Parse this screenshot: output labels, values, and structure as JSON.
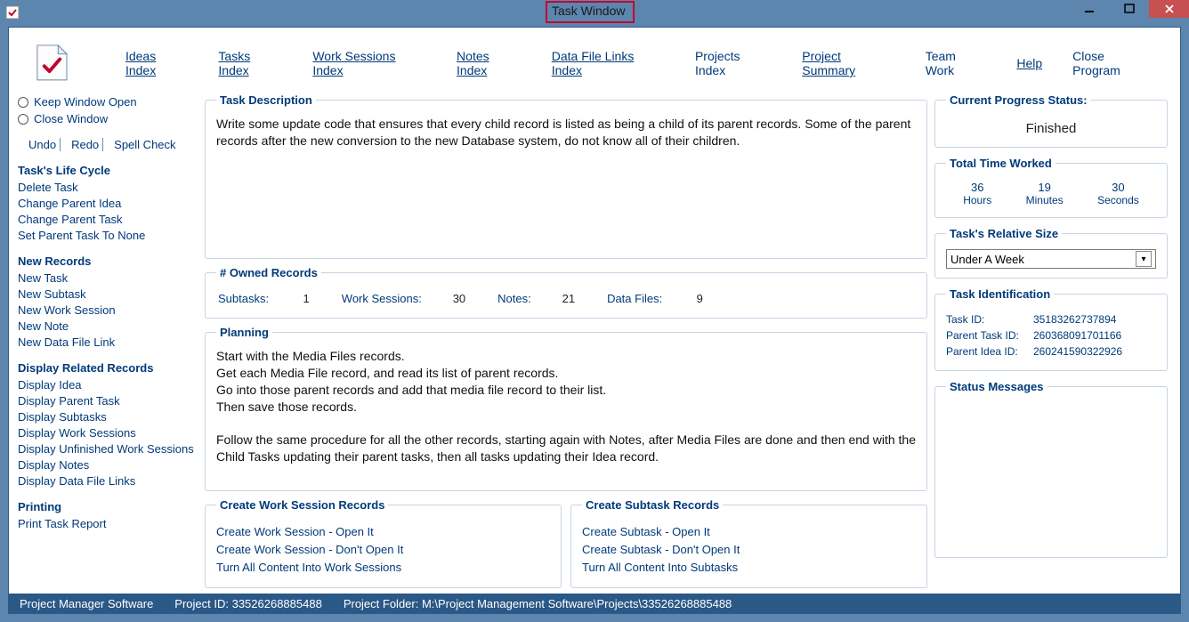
{
  "title": "Task Window",
  "menubar": {
    "items": [
      {
        "label": "Ideas Index",
        "u": 0
      },
      {
        "label": "Tasks Index",
        "u": 0
      },
      {
        "label": "Work Sessions Index",
        "u": 0
      },
      {
        "label": "Notes Index",
        "u": 0
      },
      {
        "label": "Data File Links Index",
        "u": 0
      },
      {
        "label": "Projects Index",
        "u": -1
      },
      {
        "label": "Project Summary",
        "u": 0
      },
      {
        "label": "Team Work",
        "u": -1
      },
      {
        "label": "Help",
        "u": 0
      },
      {
        "label": "Close Program",
        "u": -1
      }
    ]
  },
  "sidebar": {
    "keep_open": "Keep Window Open",
    "close": "Close Window",
    "undo": "Undo",
    "redo": "Redo",
    "spell": "Spell Check",
    "life_heading": "Task's Life Cycle",
    "life": [
      "Delete Task",
      "Change Parent Idea",
      "Change Parent Task",
      "Set Parent Task To None"
    ],
    "new_heading": "New Records",
    "new": [
      "New Task",
      "New Subtask",
      "New Work Session",
      "New Note",
      "New Data File Link"
    ],
    "disp_heading": "Display Related Records",
    "disp": [
      "Display Idea",
      "Display Parent Task",
      "Display Subtasks",
      "Display Work Sessions",
      "Display Unfinished Work Sessions",
      "Display Notes",
      "Display Data File Links"
    ],
    "print_heading": "Printing",
    "print": [
      "Print Task Report"
    ]
  },
  "desc": {
    "legend": "Task Description",
    "text": "Write some update code that ensures that every child record is listed as being a child of its parent records. Some of the parent records after the new conversion to the new Database system, do not know all of their children."
  },
  "owned": {
    "legend": "# Owned Records",
    "subtasks_l": "Subtasks:",
    "subtasks_v": "1",
    "ws_l": "Work Sessions:",
    "ws_v": "30",
    "notes_l": "Notes:",
    "notes_v": "21",
    "df_l": "Data Files:",
    "df_v": "9"
  },
  "planning": {
    "legend": "Planning",
    "text": "Start with the Media Files records.\nGet each Media File record, and read its list of parent records.\nGo into those parent records and add that media file record to their list.\nThen save those records.\n\nFollow the same procedure for all the other records, starting again with Notes, after Media Files are done and then end with the Child Tasks updating their parent tasks, then all tasks updating their Idea record."
  },
  "create_ws": {
    "legend": "Create Work Session Records",
    "links": [
      "Create Work Session - Open It",
      "Create Work Session - Don't Open It",
      "Turn All Content Into Work Sessions"
    ]
  },
  "create_sub": {
    "legend": "Create Subtask Records",
    "links": [
      "Create Subtask - Open It",
      "Create Subtask - Don't Open It",
      "Turn All Content Into Subtasks"
    ]
  },
  "progress": {
    "legend": "Current Progress Status:",
    "value": "Finished"
  },
  "time": {
    "legend": "Total Time Worked",
    "h": "36",
    "hl": "Hours",
    "m": "19",
    "ml": "Minutes",
    "s": "30",
    "sl": "Seconds"
  },
  "size": {
    "legend": "Task's Relative Size",
    "value": "Under A Week"
  },
  "ident": {
    "legend": "Task Identification",
    "task_l": "Task ID:",
    "task_v": "35183262737894",
    "pt_l": "Parent Task ID:",
    "pt_v": "260368091701166",
    "pi_l": "Parent Idea ID:",
    "pi_v": "260241590322926"
  },
  "status_msg": {
    "legend": "Status Messages"
  },
  "statusbar": {
    "app": "Project Manager Software",
    "pid_l": "Project ID:  33526268885488",
    "folder_l": "Project Folder: M:\\Project Management Software\\Projects\\33526268885488"
  }
}
